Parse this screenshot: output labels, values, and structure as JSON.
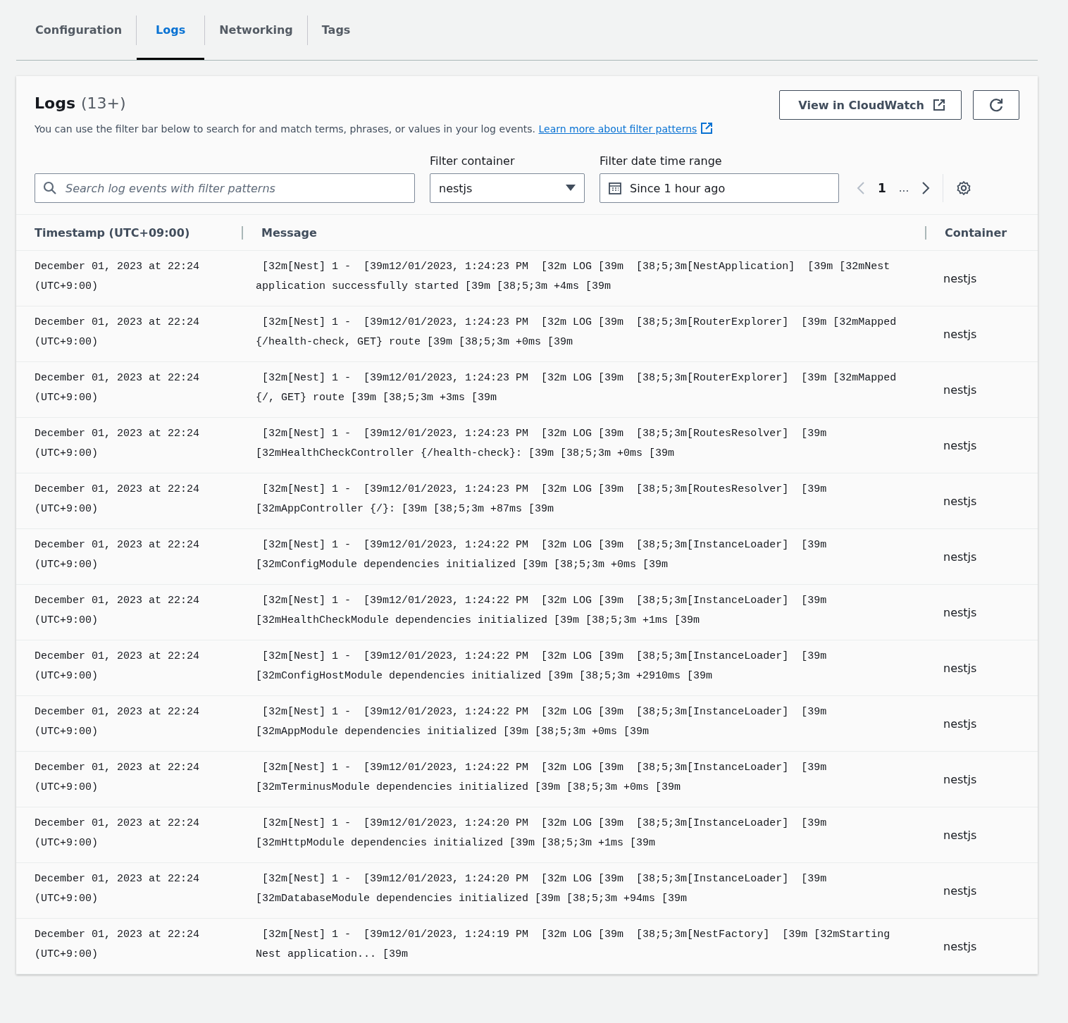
{
  "tabs": [
    {
      "label": "Configuration",
      "selected": false
    },
    {
      "label": "Logs",
      "selected": true
    },
    {
      "label": "Networking",
      "selected": false
    },
    {
      "label": "Tags",
      "selected": false
    }
  ],
  "panel": {
    "title": "Logs",
    "count": "(13+)",
    "description": "You can use the filter bar below to search for and match terms, phrases, or values in your log events.",
    "learn_more_link": "Learn more about filter patterns",
    "view_button": "View in CloudWatch"
  },
  "filters": {
    "search": {
      "placeholder": "Search log events with filter patterns"
    },
    "container": {
      "label": "Filter container",
      "value": "nestjs"
    },
    "date_range": {
      "label": "Filter date time range",
      "value": "Since 1 hour ago"
    }
  },
  "pagination": {
    "page": "1",
    "ellipsis": "...",
    "previous_disabled": true
  },
  "table": {
    "columns": [
      "Timestamp (UTC+09:00)",
      "Message",
      "Container"
    ],
    "rows": [
      {
        "timestamp": "December 01, 2023 at 22:24 (UTC+9:00)",
        "message": " [32m[Nest] 1 -  [39m12/01/2023, 1:24:23 PM  [32m LOG [39m  [38;5;3m[NestApplication]  [39m [32mNest application successfully started [39m [38;5;3m +4ms [39m",
        "container": "nestjs"
      },
      {
        "timestamp": "December 01, 2023 at 22:24 (UTC+9:00)",
        "message": " [32m[Nest] 1 -  [39m12/01/2023, 1:24:23 PM  [32m LOG [39m  [38;5;3m[RouterExplorer]  [39m [32mMapped {/health-check, GET} route [39m [38;5;3m +0ms [39m",
        "container": "nestjs"
      },
      {
        "timestamp": "December 01, 2023 at 22:24 (UTC+9:00)",
        "message": " [32m[Nest] 1 -  [39m12/01/2023, 1:24:23 PM  [32m LOG [39m  [38;5;3m[RouterExplorer]  [39m [32mMapped {/, GET} route [39m [38;5;3m +3ms [39m",
        "container": "nestjs"
      },
      {
        "timestamp": "December 01, 2023 at 22:24 (UTC+9:00)",
        "message": " [32m[Nest] 1 -  [39m12/01/2023, 1:24:23 PM  [32m LOG [39m  [38;5;3m[RoutesResolver]  [39m [32mHealthCheckController {/health-check}: [39m [38;5;3m +0ms [39m",
        "container": "nestjs"
      },
      {
        "timestamp": "December 01, 2023 at 22:24 (UTC+9:00)",
        "message": " [32m[Nest] 1 -  [39m12/01/2023, 1:24:23 PM  [32m LOG [39m  [38;5;3m[RoutesResolver]  [39m [32mAppController {/}: [39m [38;5;3m +87ms [39m",
        "container": "nestjs"
      },
      {
        "timestamp": "December 01, 2023 at 22:24 (UTC+9:00)",
        "message": " [32m[Nest] 1 -  [39m12/01/2023, 1:24:22 PM  [32m LOG [39m  [38;5;3m[InstanceLoader]  [39m [32mConfigModule dependencies initialized [39m [38;5;3m +0ms [39m",
        "container": "nestjs"
      },
      {
        "timestamp": "December 01, 2023 at 22:24 (UTC+9:00)",
        "message": " [32m[Nest] 1 -  [39m12/01/2023, 1:24:22 PM  [32m LOG [39m  [38;5;3m[InstanceLoader]  [39m [32mHealthCheckModule dependencies initialized [39m [38;5;3m +1ms [39m",
        "container": "nestjs"
      },
      {
        "timestamp": "December 01, 2023 at 22:24 (UTC+9:00)",
        "message": " [32m[Nest] 1 -  [39m12/01/2023, 1:24:22 PM  [32m LOG [39m  [38;5;3m[InstanceLoader]  [39m [32mConfigHostModule dependencies initialized [39m [38;5;3m +2910ms [39m",
        "container": "nestjs"
      },
      {
        "timestamp": "December 01, 2023 at 22:24 (UTC+9:00)",
        "message": " [32m[Nest] 1 -  [39m12/01/2023, 1:24:22 PM  [32m LOG [39m  [38;5;3m[InstanceLoader]  [39m [32mAppModule dependencies initialized [39m [38;5;3m +0ms [39m",
        "container": "nestjs"
      },
      {
        "timestamp": "December 01, 2023 at 22:24 (UTC+9:00)",
        "message": " [32m[Nest] 1 -  [39m12/01/2023, 1:24:22 PM  [32m LOG [39m  [38;5;3m[InstanceLoader]  [39m [32mTerminusModule dependencies initialized [39m [38;5;3m +0ms [39m",
        "container": "nestjs"
      },
      {
        "timestamp": "December 01, 2023 at 22:24 (UTC+9:00)",
        "message": " [32m[Nest] 1 -  [39m12/01/2023, 1:24:20 PM  [32m LOG [39m  [38;5;3m[InstanceLoader]  [39m [32mHttpModule dependencies initialized [39m [38;5;3m +1ms [39m",
        "container": "nestjs"
      },
      {
        "timestamp": "December 01, 2023 at 22:24 (UTC+9:00)",
        "message": " [32m[Nest] 1 -  [39m12/01/2023, 1:24:20 PM  [32m LOG [39m  [38;5;3m[InstanceLoader]  [39m [32mDatabaseModule dependencies initialized [39m [38;5;3m +94ms [39m",
        "container": "nestjs"
      },
      {
        "timestamp": "December 01, 2023 at 22:24 (UTC+9:00)",
        "message": " [32m[Nest] 1 -  [39m12/01/2023, 1:24:19 PM  [32m LOG [39m  [38;5;3m[NestFactory]  [39m [32mStarting Nest application... [39m",
        "container": "nestjs"
      }
    ]
  }
}
